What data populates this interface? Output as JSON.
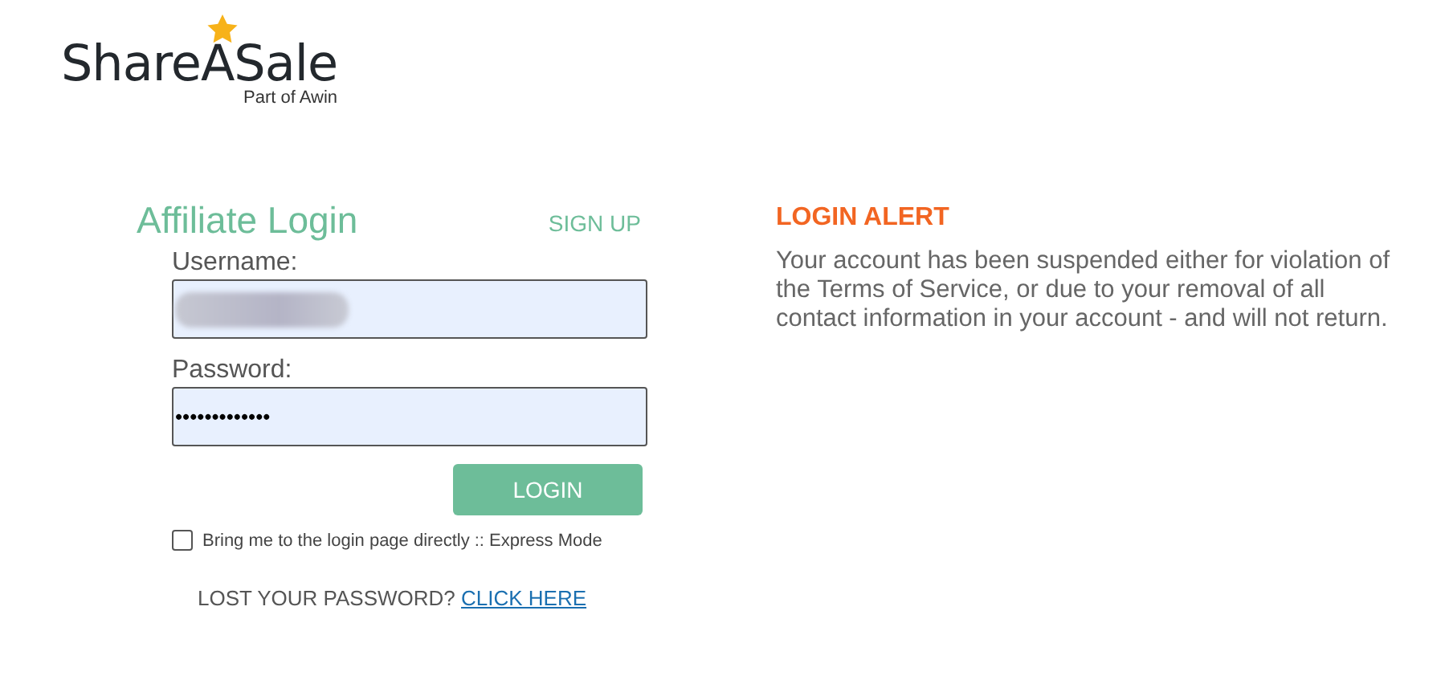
{
  "logo": {
    "name": "ShareASale",
    "tagline": "Part of Awin"
  },
  "login": {
    "title": "Affiliate Login",
    "signup_link": "SIGN UP",
    "fields": [
      {
        "label": "Username:",
        "value_blurred": true
      },
      {
        "label": "Password:",
        "value": "•••••••••••••"
      }
    ],
    "button": "LOGIN",
    "express_mode": {
      "label": "Bring me to the login page directly :: Express Mode",
      "checked": false
    },
    "lost_password": {
      "text": "LOST YOUR PASSWORD?",
      "link": "CLICK HERE"
    }
  },
  "alert": {
    "title": "LOGIN ALERT",
    "message": "Your account has been suspended either for violation of the Terms of Service, or due to your removal of all contact information in your account - and will not return."
  }
}
